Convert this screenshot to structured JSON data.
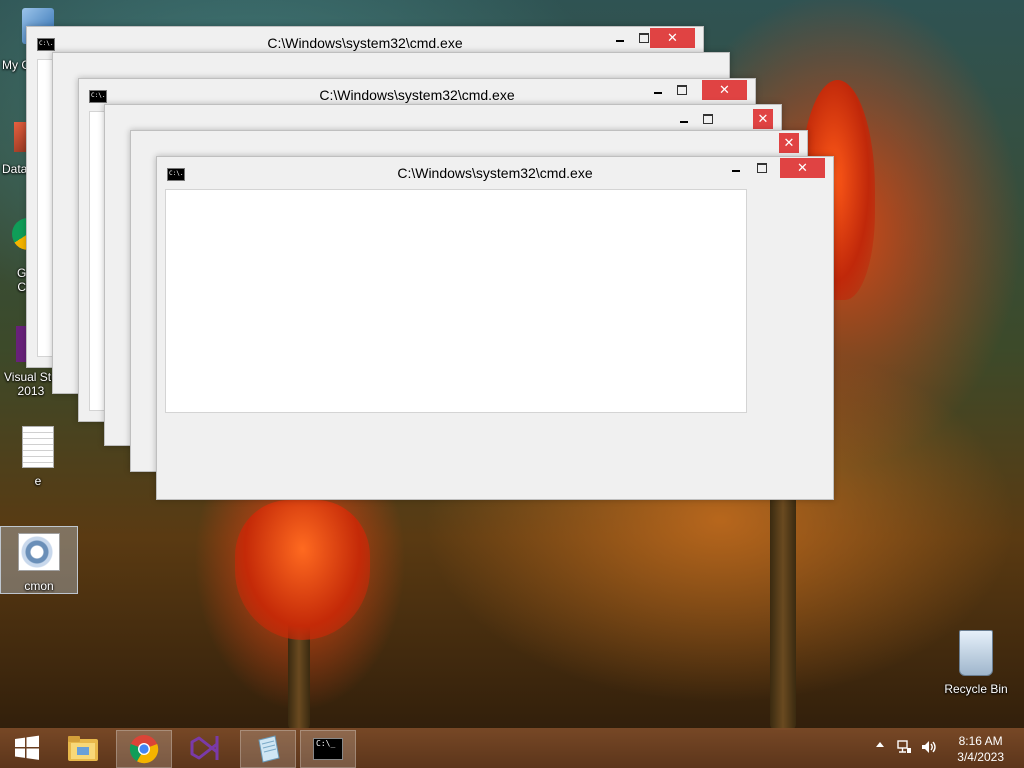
{
  "desktop": {
    "icons": [
      {
        "label": "My C"
      },
      {
        "label": "Data"
      },
      {
        "label": "G\nC"
      },
      {
        "label": "Visual Stu\n2013"
      },
      {
        "label": "e"
      },
      {
        "label": "cmon"
      },
      {
        "label": "Recycle Bin"
      }
    ]
  },
  "windows": [
    {
      "title": "C:\\Windows\\system32\\cmd.exe",
      "icon_text": "C:\\."
    },
    {
      "title": "C:\\Windows\\system32\\cmd.exe",
      "icon_text": "C:\\."
    },
    {
      "title": "C:\\Windows\\system32\\cmd.exe",
      "icon_text": "C:\\."
    }
  ],
  "window_controls": {
    "close": "✕"
  },
  "taskbar": {
    "items": [
      "start-button",
      "file-explorer",
      "chrome",
      "visual-studio",
      "notepad",
      "cmd"
    ],
    "cmd_icon_text": "C:\\_"
  },
  "clock": {
    "time": "8:16 AM",
    "date": "3/4/2023"
  },
  "colors": {
    "close_button": "#e04343",
    "window_frame": "#f0f0f0",
    "taskbar": "#7d4b28"
  }
}
